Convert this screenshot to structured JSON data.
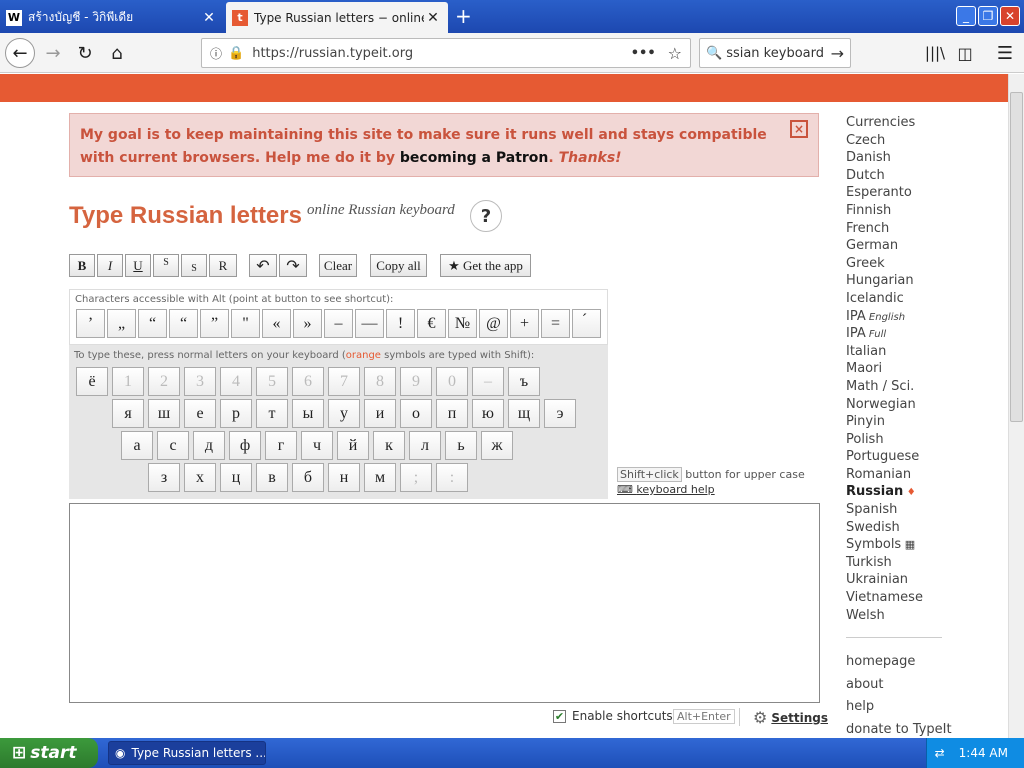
{
  "browser": {
    "tabs": [
      {
        "title": "สร้างบัญชี - วิกิพีเดีย",
        "favicon": "W"
      },
      {
        "title": "Type Russian letters − online Russi",
        "favicon": "t"
      }
    ],
    "url": "https://russian.typeit.org",
    "search_value": "ssian keyboard"
  },
  "notice": {
    "text_before": "My goal is to keep maintaining this site to make sure it runs well and stays compatible with current browsers. Help me do it by ",
    "patron_link": "becoming a Patron",
    "dot": ". ",
    "thanks": "Thanks!",
    "close_glyph": "×"
  },
  "page": {
    "title": "Type Russian letters",
    "subtitle": "online Russian keyboard",
    "help_glyph": "?"
  },
  "format_buttons": [
    "B",
    "I",
    "U",
    "S",
    "S",
    "R"
  ],
  "toolbar": {
    "undo": "↶",
    "redo": "↷",
    "clear": "Clear",
    "copy_all": "Copy all",
    "get_app": "★ Get the app"
  },
  "alt_panel": {
    "label": "Characters accessible with Alt (point at button to see shortcut):",
    "keys": [
      "’",
      "„",
      "“",
      "“",
      "”",
      "\"",
      "«",
      "»",
      "–",
      "—",
      "!",
      "€",
      "№",
      "@",
      "+",
      "=",
      "́"
    ]
  },
  "keyboard": {
    "label_before": "To type these, press normal letters on your keyboard (",
    "label_orange": "orange",
    "label_after": " symbols are typed with Shift):",
    "row1": [
      "ё",
      "1",
      "2",
      "3",
      "4",
      "5",
      "6",
      "7",
      "8",
      "9",
      "0",
      "–",
      "ъ"
    ],
    "row2": [
      "я",
      "ш",
      "е",
      "р",
      "т",
      "ы",
      "у",
      "и",
      "о",
      "п",
      "ю",
      "щ",
      "э"
    ],
    "row3": [
      "а",
      "с",
      "д",
      "ф",
      "г",
      "ч",
      "й",
      "к",
      "л",
      "ь",
      "ж"
    ],
    "row4": [
      "з",
      "х",
      "ц",
      "в",
      "б",
      "н",
      "м",
      ";",
      ":"
    ]
  },
  "hints": {
    "shift_click": "Shift+click",
    "shift_rest": " button for upper case",
    "keyboard_help": "keyboard help"
  },
  "footer_controls": {
    "enable_shortcuts": "Enable shortcuts",
    "alt_enter": "Alt+Enter",
    "settings": "Settings"
  },
  "sidebar": {
    "languages": [
      {
        "label": "Currencies"
      },
      {
        "label": "Czech"
      },
      {
        "label": "Danish"
      },
      {
        "label": "Dutch"
      },
      {
        "label": "Esperanto"
      },
      {
        "label": "Finnish"
      },
      {
        "label": "French"
      },
      {
        "label": "German"
      },
      {
        "label": "Greek"
      },
      {
        "label": "Hungarian"
      },
      {
        "label": "Icelandic"
      },
      {
        "label": "IPA",
        "sub": "English"
      },
      {
        "label": "IPA",
        "sub": "Full"
      },
      {
        "label": "Italian"
      },
      {
        "label": "Maori"
      },
      {
        "label": "Math / Sci."
      },
      {
        "label": "Norwegian"
      },
      {
        "label": "Pinyin"
      },
      {
        "label": "Polish"
      },
      {
        "label": "Portuguese"
      },
      {
        "label": "Romanian"
      },
      {
        "label": "Russian",
        "active": true
      },
      {
        "label": "Spanish"
      },
      {
        "label": "Swedish"
      },
      {
        "label": "Symbols"
      },
      {
        "label": "Turkish"
      },
      {
        "label": "Ukrainian"
      },
      {
        "label": "Vietnamese"
      },
      {
        "label": "Welsh"
      }
    ],
    "links": [
      "homepage",
      "about",
      "help",
      "donate to TypeIt"
    ]
  },
  "taskbar": {
    "start": "start",
    "task": "Type Russian letters ...",
    "clock": "1:44 AM"
  },
  "colors": {
    "accent": "#e65a33",
    "title": "#d5643f",
    "notice_bg": "#f2d7d5"
  }
}
